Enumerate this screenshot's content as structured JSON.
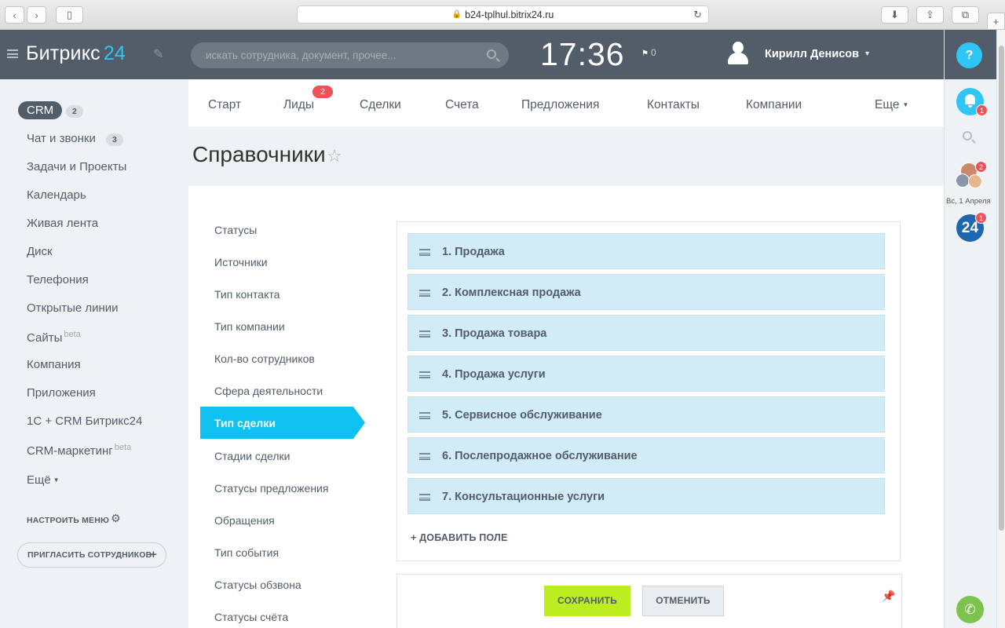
{
  "browser": {
    "url": "b24-tplhul.bitrix24.ru"
  },
  "header": {
    "logo_text": "Битрикс",
    "logo_num": "24",
    "search_placeholder": "искать сотрудника, документ, прочее...",
    "clock": "17:36",
    "flag_count": "0",
    "user_name": "Кирилл Денисов",
    "accent_color": "#2fc6f6",
    "header_color": "#535c69"
  },
  "right_panel": {
    "help_label": "?",
    "notifications_count": "1",
    "chat_count": "2",
    "date_label": "Вс, 1 Апреля",
    "b24_label": "24",
    "b24_count": "1"
  },
  "sidebar": {
    "items": [
      {
        "label": "CRM",
        "count": "2"
      },
      {
        "label": "Чат и звонки",
        "count": "3"
      },
      {
        "label": "Задачи и Проекты"
      },
      {
        "label": "Календарь"
      },
      {
        "label": "Живая лента"
      },
      {
        "label": "Диск"
      },
      {
        "label": "Телефония"
      },
      {
        "label": "Открытые линии"
      },
      {
        "label": "Сайты",
        "beta": "beta"
      },
      {
        "label": "Компания"
      },
      {
        "label": "Приложения"
      },
      {
        "label": "1С + CRM Битрикс24"
      },
      {
        "label": "CRM-маркетинг",
        "beta": "beta"
      },
      {
        "label": "Ещё"
      }
    ],
    "settings_label": "НАСТРОИТЬ МЕНЮ",
    "invite_label": "ПРИГЛАСИТЬ СОТРУДНИКОВ",
    "invite_plus": "+"
  },
  "nav": {
    "tabs": [
      {
        "label": "Старт"
      },
      {
        "label": "Лиды",
        "badge": "2"
      },
      {
        "label": "Сделки"
      },
      {
        "label": "Счета"
      },
      {
        "label": "Предложения"
      },
      {
        "label": "Контакты"
      },
      {
        "label": "Компании"
      },
      {
        "label": "Еще"
      }
    ]
  },
  "page": {
    "title": "Справочники",
    "star": "☆"
  },
  "submenu": {
    "items": [
      {
        "label": "Статусы"
      },
      {
        "label": "Источники"
      },
      {
        "label": "Тип контакта"
      },
      {
        "label": "Тип компании"
      },
      {
        "label": "Кол-во сотрудников"
      },
      {
        "label": "Сфера деятельности"
      },
      {
        "label": "Тип сделки",
        "active": true
      },
      {
        "label": "Стадии сделки"
      },
      {
        "label": "Статусы предложения"
      },
      {
        "label": "Обращения"
      },
      {
        "label": "Тип события"
      },
      {
        "label": "Статусы обзвона"
      },
      {
        "label": "Статусы счёта"
      }
    ]
  },
  "deal_types": {
    "rows": [
      {
        "label": "1. Продажа"
      },
      {
        "label": "2. Комплексная продажа"
      },
      {
        "label": "3. Продажа товара"
      },
      {
        "label": "4. Продажа услуги"
      },
      {
        "label": "5. Сервисное обслуживание"
      },
      {
        "label": "6. Послепродажное обслуживание"
      },
      {
        "label": "7. Консультационные услуги"
      }
    ],
    "add_field_label": "+ ДОБАВИТЬ ПОЛЕ"
  },
  "footer": {
    "save_label": "СОХРАНИТЬ",
    "cancel_label": "ОТМЕНИТЬ",
    "save_color": "#bbed21"
  }
}
